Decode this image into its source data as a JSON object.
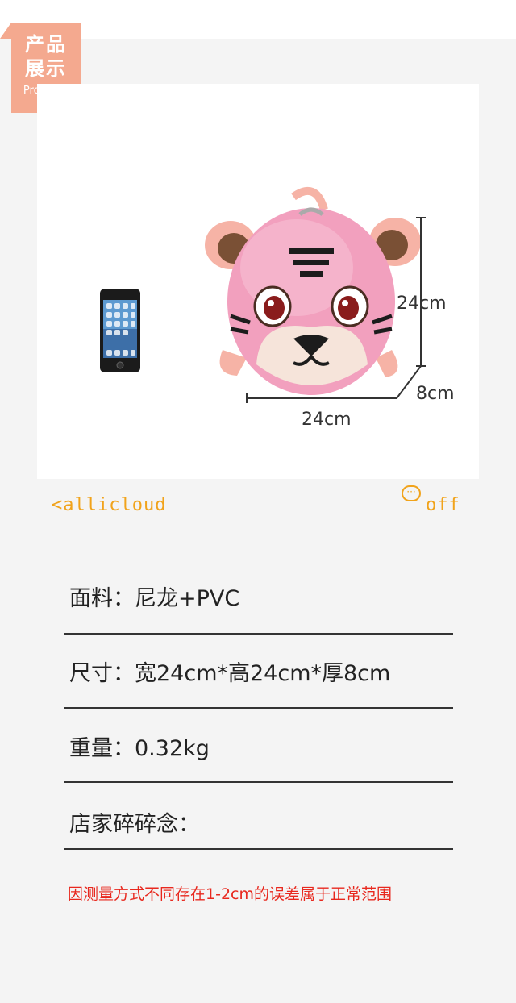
{
  "badge": {
    "line1": "产品",
    "line2": "展示",
    "en": "Products"
  },
  "photo": {
    "dimensions": {
      "height": "24cm",
      "depth": "8cm",
      "width": "24cm"
    },
    "colors": {
      "pink": "#f2a0be",
      "pink_dark": "#e47aa3",
      "strap": "#f6b3a6",
      "ear": "#7a5035"
    }
  },
  "brand": {
    "logo_text": "<allicloud",
    "off_text": "off",
    "off_icon": "chat-bubble-icon",
    "color": "#f1a31b"
  },
  "specs": [
    {
      "label": "面料：尼龙+PVC"
    },
    {
      "label": "尺寸：宽24cm*高24cm*厚8cm"
    },
    {
      "label": "重量：0.32kg"
    },
    {
      "label": "店家碎碎念："
    }
  ],
  "note": {
    "text": "因测量方式不同存在1-2cm的误差属于正常范围",
    "color": "#e8281e"
  }
}
